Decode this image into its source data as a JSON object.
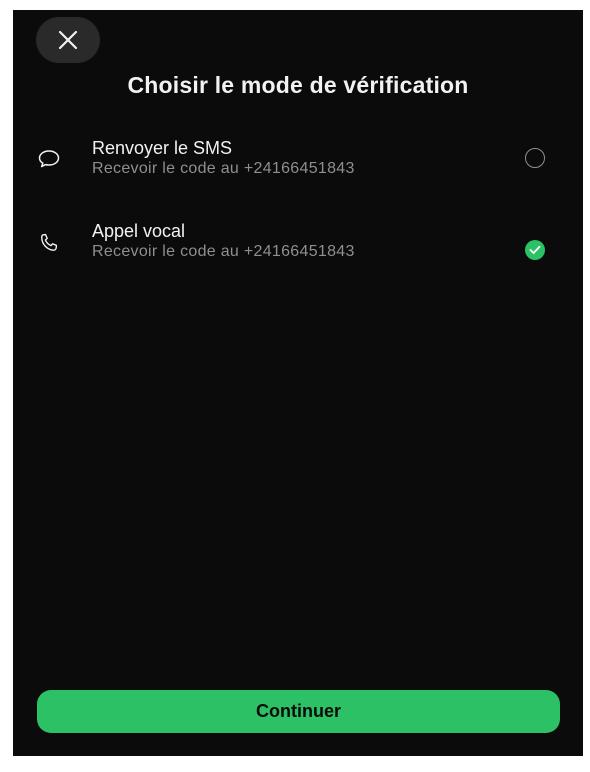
{
  "header": {
    "close_icon": "close-icon",
    "title": "Choisir le mode de vérification"
  },
  "options": [
    {
      "icon": "chat-bubble-icon",
      "label": "Renvoyer le SMS",
      "sublabel": "Recevoir le code au +24166451843",
      "selected": false
    },
    {
      "icon": "phone-icon",
      "label": "Appel vocal",
      "sublabel": "Recevoir le code au +24166451843",
      "selected": true
    }
  ],
  "footer": {
    "continue_label": "Continuer"
  },
  "colors": {
    "background": "#0b0b0b",
    "accent": "#2cc164",
    "text": "#f2f2f2",
    "secondary_text": "#8e8e93"
  }
}
